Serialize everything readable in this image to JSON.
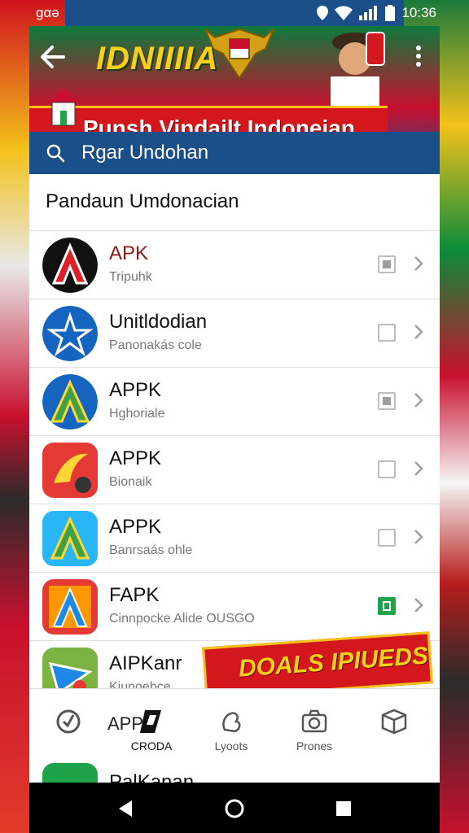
{
  "status_bar": {
    "carrier": "ɡαə",
    "time": "10:36",
    "icons": [
      "location-icon",
      "wifi-icon",
      "signal-icon",
      "battery-icon"
    ]
  },
  "header": {
    "banner_title": "IDNIIIIA",
    "banner_subtitle": "Punsh Vindailt Indoneian"
  },
  "search": {
    "query": "Rgar Undohan"
  },
  "list": {
    "title": "Pandaun Umdonacian",
    "items": [
      {
        "name": "APK",
        "subtitle": "Tripuhk",
        "checkbox": "filled",
        "icon_colors": [
          "#111111",
          "#e01e26",
          "#ffffff"
        ],
        "name_color": "#8b1a1a"
      },
      {
        "name": "Unitldodian",
        "subtitle": "Panonakás cole",
        "checkbox": "empty",
        "icon_colors": [
          "#1565c0",
          "#ffffff"
        ],
        "name_color": "#111111"
      },
      {
        "name": "APPK",
        "subtitle": "Hghoriale",
        "checkbox": "filled",
        "icon_colors": [
          "#1565c0",
          "#43a047",
          "#fdd835"
        ],
        "name_color": "#111111"
      },
      {
        "name": "APPK",
        "subtitle": "Bionaik",
        "checkbox": "empty",
        "icon_colors": [
          "#e53935",
          "#fdd835"
        ],
        "name_color": "#111111"
      },
      {
        "name": "APPK",
        "subtitle": "Banrsaás ohle",
        "checkbox": "empty",
        "icon_colors": [
          "#29b6f6",
          "#43a047",
          "#fdd835"
        ],
        "name_color": "#111111"
      },
      {
        "name": "FAPK",
        "subtitle": "Cinnpocke Alide OUSGO",
        "checkbox": "green",
        "icon_colors": [
          "#e53935",
          "#ff9800",
          "#1e88e5"
        ],
        "name_color": "#111111"
      },
      {
        "name": "AIPKanr",
        "subtitle": "Kiunoebce",
        "checkbox": "none",
        "icon_colors": [
          "#7cb342",
          "#1e88e5",
          "#e53935"
        ],
        "name_color": "#111111"
      }
    ]
  },
  "promo": {
    "text": "DOALS IPIUEDS"
  },
  "bottom_nav": {
    "items": [
      {
        "label": "",
        "icon": "refresh-circle-icon"
      },
      {
        "label": "CRODA",
        "icon": "app-brand-icon",
        "overlay": "APP"
      },
      {
        "label": "Lyoots",
        "icon": "hands-icon"
      },
      {
        "label": "Prones",
        "icon": "camera-icon"
      },
      {
        "label": "",
        "icon": "box-icon"
      }
    ]
  },
  "peek_item": {
    "name": "PalKanan"
  },
  "colors": {
    "primary_blue": "#1b4f8a",
    "accent_red": "#d4161d",
    "accent_yellow": "#f4c21a",
    "check_green": "#1fa34a"
  }
}
